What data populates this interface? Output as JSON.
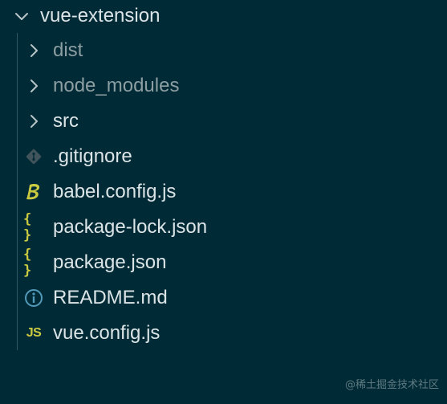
{
  "explorer": {
    "root": {
      "label": "vue-extension",
      "icon": "chevron-down-icon",
      "expanded": true
    },
    "items": [
      {
        "label": "dist",
        "type": "folder",
        "icon": "chevron-right-icon",
        "dimmed": true
      },
      {
        "label": "node_modules",
        "type": "folder",
        "icon": "chevron-right-icon",
        "dimmed": true
      },
      {
        "label": "src",
        "type": "folder",
        "icon": "chevron-right-icon",
        "dimmed": false
      },
      {
        "label": ".gitignore",
        "type": "file",
        "icon": "git-icon",
        "dimmed": false
      },
      {
        "label": "babel.config.js",
        "type": "file",
        "icon": "babel-icon",
        "dimmed": false
      },
      {
        "label": "package-lock.json",
        "type": "file",
        "icon": "json-braces-icon",
        "dimmed": false
      },
      {
        "label": "package.json",
        "type": "file",
        "icon": "json-braces-icon",
        "dimmed": false
      },
      {
        "label": "README.md",
        "type": "file",
        "icon": "info-icon",
        "dimmed": false
      },
      {
        "label": "vue.config.js",
        "type": "file",
        "icon": "js-icon",
        "dimmed": false
      }
    ]
  },
  "icons": {
    "json_glyph": "{ }",
    "js_glyph": "JS"
  },
  "watermark": "@稀土掘金技术社区",
  "colors": {
    "background": "#002b36",
    "text": "#dbe4e6",
    "text_dim": "#8c9ea2",
    "icon_yellow": "#cbcb41",
    "icon_info": "#519aba",
    "icon_git": "#41535b",
    "chevron": "#b8c5c8",
    "guide_line": "#2e5663"
  }
}
